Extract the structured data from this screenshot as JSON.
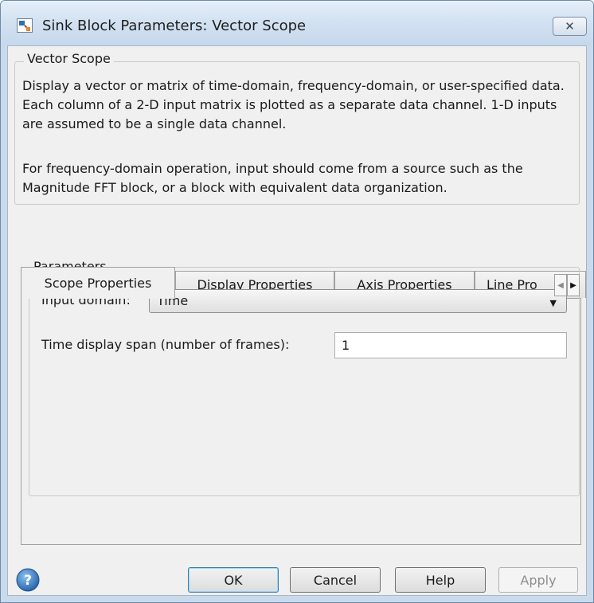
{
  "window": {
    "title": "Sink Block Parameters: Vector Scope",
    "close_symbol": "✕"
  },
  "block": {
    "name": "Vector Scope",
    "description_1": "Display a vector or matrix of time-domain, frequency-domain, or user-specified data.  Each column of a 2-D input matrix is plotted as a separate data channel.  1-D inputs are assumed to be a single data channel.",
    "description_2": "For frequency-domain operation, input should come from a source such as the Magnitude FFT block, or a block with equivalent data organization."
  },
  "tabs": [
    {
      "label": "Scope Properties",
      "active": true
    },
    {
      "label": "Display Properties",
      "active": false
    },
    {
      "label": "Axis Properties",
      "active": false
    },
    {
      "label": "Line Pro",
      "active": false
    }
  ],
  "scroll_arrows": {
    "left": "◀",
    "right": "▶"
  },
  "parameters": {
    "group_label": "Parameters",
    "input_domain_label": "Input domain:",
    "input_domain_value": "Time",
    "caret": "▼",
    "span_label": "Time display span (number of frames):",
    "span_value": "1"
  },
  "buttons": {
    "ok": "OK",
    "cancel": "Cancel",
    "help": "Help",
    "apply": "Apply"
  },
  "icons": {
    "title": "simulink-block-icon",
    "help": "help-circle-icon"
  },
  "colors": {
    "title_bar": "#d3e2f2",
    "dialog_bg": "#f0f0f0",
    "default_button_border": "#3c7fb1",
    "help_icon": "#2f6db8"
  }
}
